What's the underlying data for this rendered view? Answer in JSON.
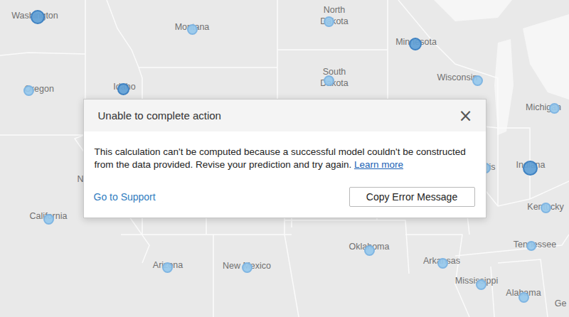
{
  "map": {
    "states": [
      {
        "label": "Washington",
        "pin": true,
        "level": 0.9
      },
      {
        "label": "Montana",
        "pin": true,
        "level": 0.3
      },
      {
        "label": "North Dakota",
        "pin": true,
        "level": 0.3
      },
      {
        "label": "Minnesota",
        "pin": true,
        "level": 0.7
      },
      {
        "label": "Oregon",
        "pin": true,
        "level": 0.3
      },
      {
        "label": "Idaho",
        "pin": true,
        "level": 0.55
      },
      {
        "label": "South Dakota",
        "pin": true,
        "level": 0.3
      },
      {
        "label": "Wisconsin",
        "pin": true,
        "level": 0.3
      },
      {
        "label": "Michigan",
        "pin": true,
        "level": 0.35
      },
      {
        "label": "N",
        "pin": false,
        "level": 0
      },
      {
        "label": "California",
        "pin": true,
        "level": 0.35
      },
      {
        "label": "is",
        "pin": true,
        "level": 0.3
      },
      {
        "label": "Indiana",
        "pin": true,
        "level": 0.95
      },
      {
        "label": "Kentucky",
        "pin": true,
        "level": 0.3
      },
      {
        "label": "Oklahoma",
        "pin": true,
        "level": 0.3
      },
      {
        "label": "Arkansas",
        "pin": true,
        "level": 0.3
      },
      {
        "label": "Tennessee",
        "pin": true,
        "level": 0.25
      },
      {
        "label": "Arizona",
        "pin": true,
        "level": 0.3
      },
      {
        "label": "New Mexico",
        "pin": true,
        "level": 0.3
      },
      {
        "label": "Mississippi",
        "pin": true,
        "level": 0.3
      },
      {
        "label": "Alabama",
        "pin": true,
        "level": 0.35
      },
      {
        "label": "Ge",
        "pin": false,
        "level": 0
      }
    ]
  },
  "dialog": {
    "title": "Unable to complete action",
    "close": "×",
    "message": "This calculation can't be computed because a successful model couldn't be constructed from the data provided. Revise your prediction and try again.",
    "link": "Learn more",
    "support_link": "Go to Support",
    "button": "Copy Error Message"
  }
}
